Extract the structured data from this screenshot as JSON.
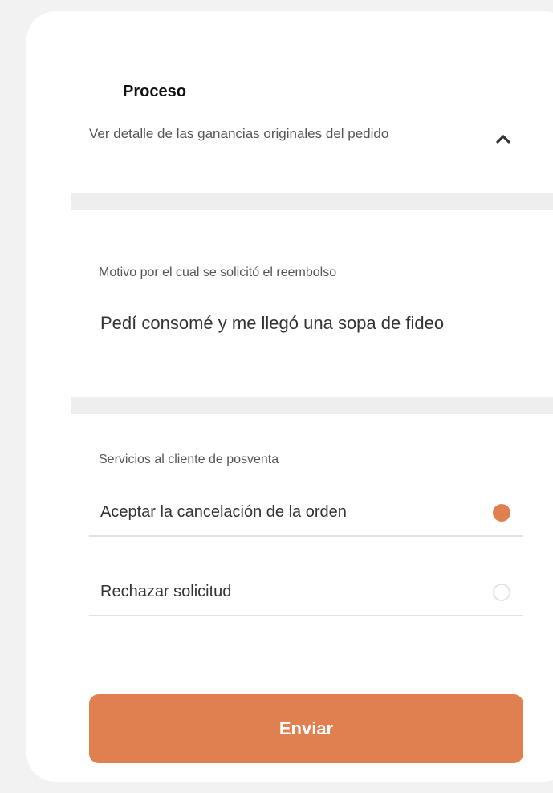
{
  "header": {
    "title": "Proceso"
  },
  "details": {
    "toggle_label": "Ver detalle de las ganancias originales del pedido",
    "toggle_icon": "chevron-up-icon"
  },
  "refund": {
    "reason_label": "Motivo por el cual se solicitó el reembolso",
    "reason_value": "Pedí consomé y me llegó una sopa de fideo"
  },
  "services": {
    "label": "Servicios al cliente de posventa",
    "options": [
      {
        "label": "Aceptar la cancelación de la orden",
        "selected": true
      },
      {
        "label": "Rechazar solicitud",
        "selected": false
      }
    ]
  },
  "submit": {
    "label": "Enviar"
  },
  "colors": {
    "accent": "#e08050",
    "background": "#f2f2f2",
    "card": "#ffffff",
    "divider": "#eeeeee"
  }
}
